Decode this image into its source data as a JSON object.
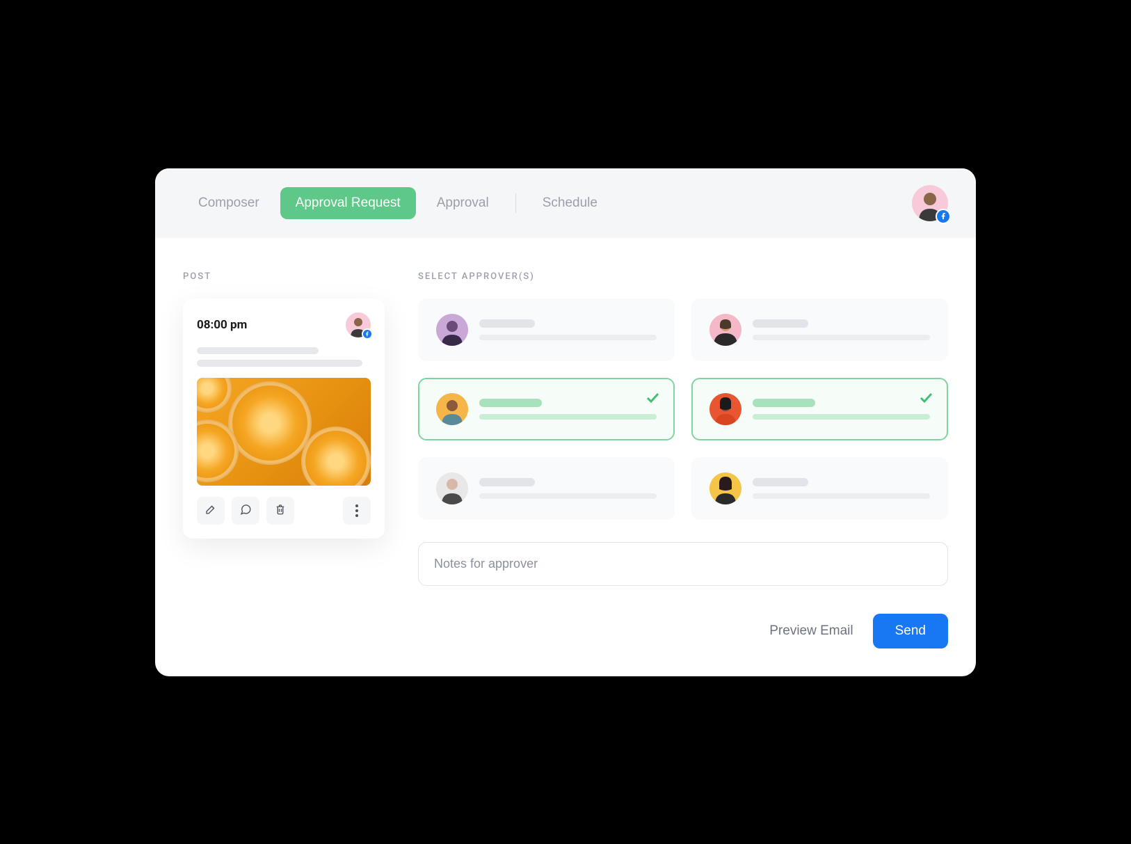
{
  "header": {
    "tabs": [
      {
        "label": "Composer",
        "active": false
      },
      {
        "label": "Approval Request",
        "active": true
      },
      {
        "label": "Approval",
        "active": false
      },
      {
        "label": "Schedule",
        "active": false
      }
    ],
    "network_icon": "facebook-icon"
  },
  "post": {
    "section_label": "POST",
    "time": "08:00 pm",
    "network_icon": "facebook-icon",
    "image_desc": "orange-slices"
  },
  "approvers": {
    "section_label": "SELECT APPROVER(S)",
    "list": [
      {
        "selected": false,
        "avatar_bg": "#c9a8d8"
      },
      {
        "selected": false,
        "avatar_bg": "#f5b8c8"
      },
      {
        "selected": true,
        "avatar_bg": "#f5b548"
      },
      {
        "selected": true,
        "avatar_bg": "#e85530"
      },
      {
        "selected": false,
        "avatar_bg": "#d8d8d8"
      },
      {
        "selected": false,
        "avatar_bg": "#f5c548"
      }
    ]
  },
  "notes": {
    "placeholder": "Notes for approver",
    "value": ""
  },
  "footer": {
    "preview_label": "Preview Email",
    "send_label": "Send"
  },
  "colors": {
    "accent_green": "#5dc887",
    "accent_blue": "#1877f2",
    "selected_border": "#7fd4a0"
  }
}
